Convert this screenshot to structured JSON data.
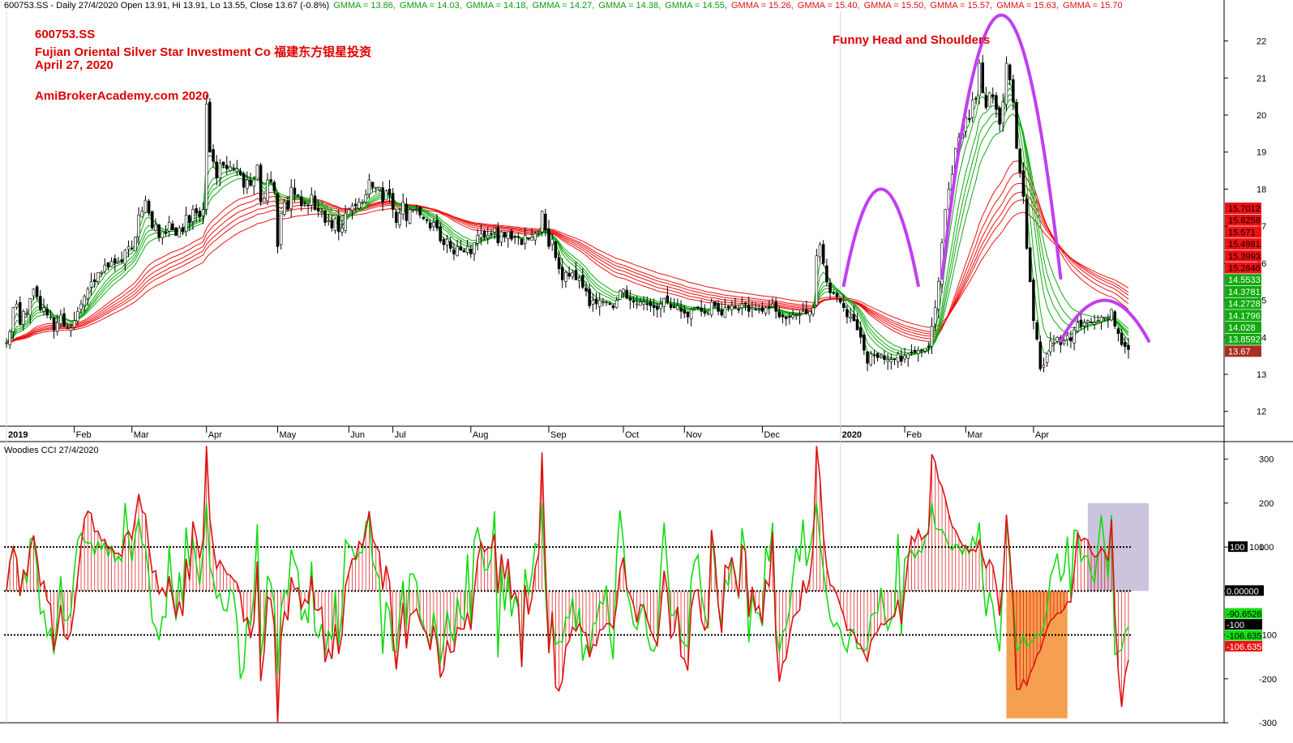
{
  "header": {
    "symbol_line": "600753.SS - Daily 27/4/2020 Open 13.91, Hi 13.91, Lo 13.55, Close 13.67 (-0.8%)",
    "gmma": [
      {
        "text": "GMMA = 13.86,",
        "color": "#119911"
      },
      {
        "text": "GMMA = 14.03,",
        "color": "#119911"
      },
      {
        "text": "GMMA = 14.18,",
        "color": "#119911"
      },
      {
        "text": "GMMA = 14.27,",
        "color": "#119911"
      },
      {
        "text": "GMMA = 14.38,",
        "color": "#119911"
      },
      {
        "text": "GMMA = 14.55,",
        "color": "#119911"
      },
      {
        "text": "GMMA = 15.26,",
        "color": "#dd1111"
      },
      {
        "text": "GMMA = 15.40,",
        "color": "#dd1111"
      },
      {
        "text": "GMMA = 15.50,",
        "color": "#dd1111"
      },
      {
        "text": "GMMA = 15.57,",
        "color": "#dd1111"
      },
      {
        "text": "GMMA = 15.63,",
        "color": "#dd1111"
      },
      {
        "text": "GMMA = 15.70",
        "color": "#dd1111"
      }
    ]
  },
  "annotations": {
    "ticker": "600753.SS",
    "company": "Fujian Oriental Silver Star Investment Co 福建东方银星投资",
    "date": "April 27, 2020",
    "site": "AmiBrokerAcademy.com   2020",
    "pattern": "Funny Head and Shoulders"
  },
  "colors": {
    "up_candle": "#ffffff",
    "down_candle": "#000000",
    "candle_outline": "#000000",
    "short_ema": "#11aa11",
    "long_ema": "#ee1111",
    "arc": "#c040f0",
    "cci_bull": "#11dd11",
    "cci_bear": "#dd1111",
    "overbought_box": "#ccc4dd",
    "oversold_box": "#f5a050"
  },
  "chart_data": [
    {
      "type": "candlestick",
      "title": "600753.SS Daily",
      "yticks": [
        "12",
        "13",
        "14",
        "15",
        "16",
        "17",
        "18",
        "19",
        "20",
        "21",
        "22"
      ],
      "ylim": [
        11.6,
        22.8
      ],
      "month_labels": [
        "2019",
        "Feb",
        "Mar",
        "Apr",
        "May",
        "Jun",
        "Jul",
        "Aug",
        "Sep",
        "Oct",
        "Nov",
        "Dec",
        "2020",
        "Feb",
        "Mar",
        "Apr"
      ],
      "month_start_index": [
        0,
        20,
        37,
        59,
        80,
        101,
        114,
        137,
        160,
        182,
        200,
        223,
        246,
        265,
        283,
        303
      ],
      "close": [
        13.85,
        14.15,
        14.8,
        14.9,
        14.35,
        14.7,
        14.65,
        15.05,
        15.3,
        15.1,
        14.75,
        14.8,
        14.6,
        14.55,
        14.2,
        14.4,
        14.6,
        14.3,
        14.25,
        14.25,
        14.45,
        14.7,
        14.9,
        15.1,
        15.3,
        15.5,
        15.5,
        15.75,
        15.75,
        15.95,
        15.9,
        16.05,
        16.0,
        16.05,
        16.05,
        16.35,
        16.45,
        16.4,
        16.7,
        17.3,
        17.4,
        17.7,
        17.35,
        16.95,
        17.05,
        16.7,
        16.85,
        16.8,
        17.1,
        16.9,
        16.75,
        16.95,
        16.85,
        17.3,
        17.1,
        17.45,
        17.35,
        17.25,
        17.45,
        20.3,
        19.0,
        18.75,
        18.3,
        18.7,
        18.65,
        18.55,
        18.6,
        18.55,
        18.55,
        18.4,
        18.05,
        18.25,
        18.1,
        18.25,
        18.65,
        17.65,
        17.75,
        18.25,
        18.2,
        17.95,
        16.45,
        17.35,
        17.65,
        17.45,
        18.05,
        17.85,
        17.85,
        17.55,
        17.6,
        17.55,
        17.85,
        17.45,
        17.4,
        17.4,
        17.1,
        17.15,
        16.95,
        17.2,
        16.85,
        16.95,
        17.35,
        17.45,
        17.55,
        17.55,
        17.65,
        17.65,
        17.85,
        18.25,
        18.05,
        18.05,
        18.05,
        17.65,
        17.95,
        17.85,
        17.45,
        17.1,
        17.35,
        17.65,
        17.15,
        17.45,
        17.45,
        17.45,
        17.3,
        17.2,
        17.15,
        16.95,
        17.1,
        16.95,
        16.6,
        16.5,
        16.65,
        16.4,
        16.25,
        16.45,
        16.35,
        16.3,
        16.45,
        16.25,
        16.55,
        16.75,
        16.8,
        16.7,
        16.75,
        16.8,
        16.95,
        16.55,
        16.85,
        16.7,
        16.85,
        16.65,
        16.7,
        16.7,
        16.5,
        16.75,
        16.65,
        16.7,
        16.8,
        16.85,
        17.4,
        16.9,
        16.45,
        16.65,
        16.15,
        15.85,
        15.55,
        15.75,
        15.65,
        15.75,
        15.55,
        15.6,
        15.35,
        15.25,
        14.85,
        15.0,
        14.9,
        15.0,
        14.95,
        14.95,
        14.9,
        14.8,
        15.0,
        15.25,
        15.3,
        15.05,
        15.0,
        14.95,
        14.9,
        14.95,
        14.95,
        14.9,
        14.85,
        14.8,
        14.75,
        14.9,
        15.05,
        14.95,
        14.8,
        14.8,
        14.85,
        14.7,
        14.65,
        14.55,
        14.75,
        14.8,
        14.8,
        14.7,
        14.65,
        14.65,
        14.95,
        14.85,
        14.7,
        14.6,
        14.8,
        14.8,
        14.85,
        14.8,
        14.75,
        14.9,
        14.9,
        14.7,
        14.8,
        14.75,
        14.75,
        14.7,
        14.8,
        14.8,
        14.9,
        14.7,
        14.55,
        14.55,
        14.5,
        14.55,
        14.6,
        14.6,
        14.6,
        14.7,
        14.65,
        14.7,
        14.8,
        16.2,
        16.5,
        16.0,
        15.5,
        15.2,
        15.2,
        15.1,
        14.95,
        14.8,
        14.55,
        14.55,
        14.45,
        14.2,
        14.0,
        13.65,
        13.3,
        13.55,
        13.5,
        13.45,
        13.5,
        13.4,
        13.4,
        13.4,
        13.4,
        13.55,
        13.35,
        13.5,
        13.55,
        13.6,
        13.6,
        13.65,
        13.65,
        13.7,
        13.75,
        14.3,
        14.8,
        15.5,
        16.55,
        17.45,
        18.0,
        18.4,
        19.1,
        19.4,
        19.5,
        19.95,
        19.9,
        20.4,
        20.45,
        21.4,
        20.6,
        20.2,
        20.6,
        20.5,
        20.15,
        19.75,
        20.35,
        21.4,
        20.95,
        20.35,
        19.1,
        18.45,
        17.8,
        16.4,
        15.5,
        14.45,
        13.95,
        13.15,
        13.25,
        13.55,
        13.9,
        13.85,
        14.0,
        13.8,
        13.9,
        14.05,
        13.9,
        14.2,
        14.4,
        14.3,
        14.4,
        14.45,
        14.4,
        14.4,
        14.45,
        14.55,
        14.55,
        14.5,
        14.75,
        14.3,
        14.1,
        13.8,
        13.75,
        13.67
      ]
    },
    {
      "type": "line",
      "title": "Woodies CCI  27/4/2020",
      "yticks": [
        "-300",
        "-200",
        "-100",
        "0",
        "100",
        "200",
        "300"
      ],
      "ylim": [
        -300,
        340
      ],
      "reference_lines": [
        100,
        0,
        -100
      ],
      "last_values": [
        "-90.6526",
        "-100",
        "-106.635",
        "-106.635"
      ],
      "right_labels": [
        "100",
        "0.00000"
      ]
    }
  ],
  "right_axis_labels": [
    {
      "text": "15.7012",
      "bg": "#ee1111",
      "fg": "#000"
    },
    {
      "text": "15.6258",
      "bg": "#ee1111",
      "fg": "#000"
    },
    {
      "text": "15.571",
      "bg": "#ee1111",
      "fg": "#000"
    },
    {
      "text": "15.4981",
      "bg": "#ee1111",
      "fg": "#000"
    },
    {
      "text": "15.3993",
      "bg": "#ee1111",
      "fg": "#000"
    },
    {
      "text": "15.2646",
      "bg": "#ee1111",
      "fg": "#000"
    },
    {
      "text": "14.5533",
      "bg": "#11aa11",
      "fg": "#fff"
    },
    {
      "text": "14.3781",
      "bg": "#11aa11",
      "fg": "#fff"
    },
    {
      "text": "14.2728",
      "bg": "#11aa11",
      "fg": "#fff"
    },
    {
      "text": "14.1796",
      "bg": "#11aa11",
      "fg": "#fff"
    },
    {
      "text": "14.028",
      "bg": "#11aa11",
      "fg": "#fff"
    },
    {
      "text": "13.8592",
      "bg": "#11aa11",
      "fg": "#fff"
    },
    {
      "text": "13.67",
      "bg": "#a83020",
      "fg": "#fff"
    }
  ]
}
